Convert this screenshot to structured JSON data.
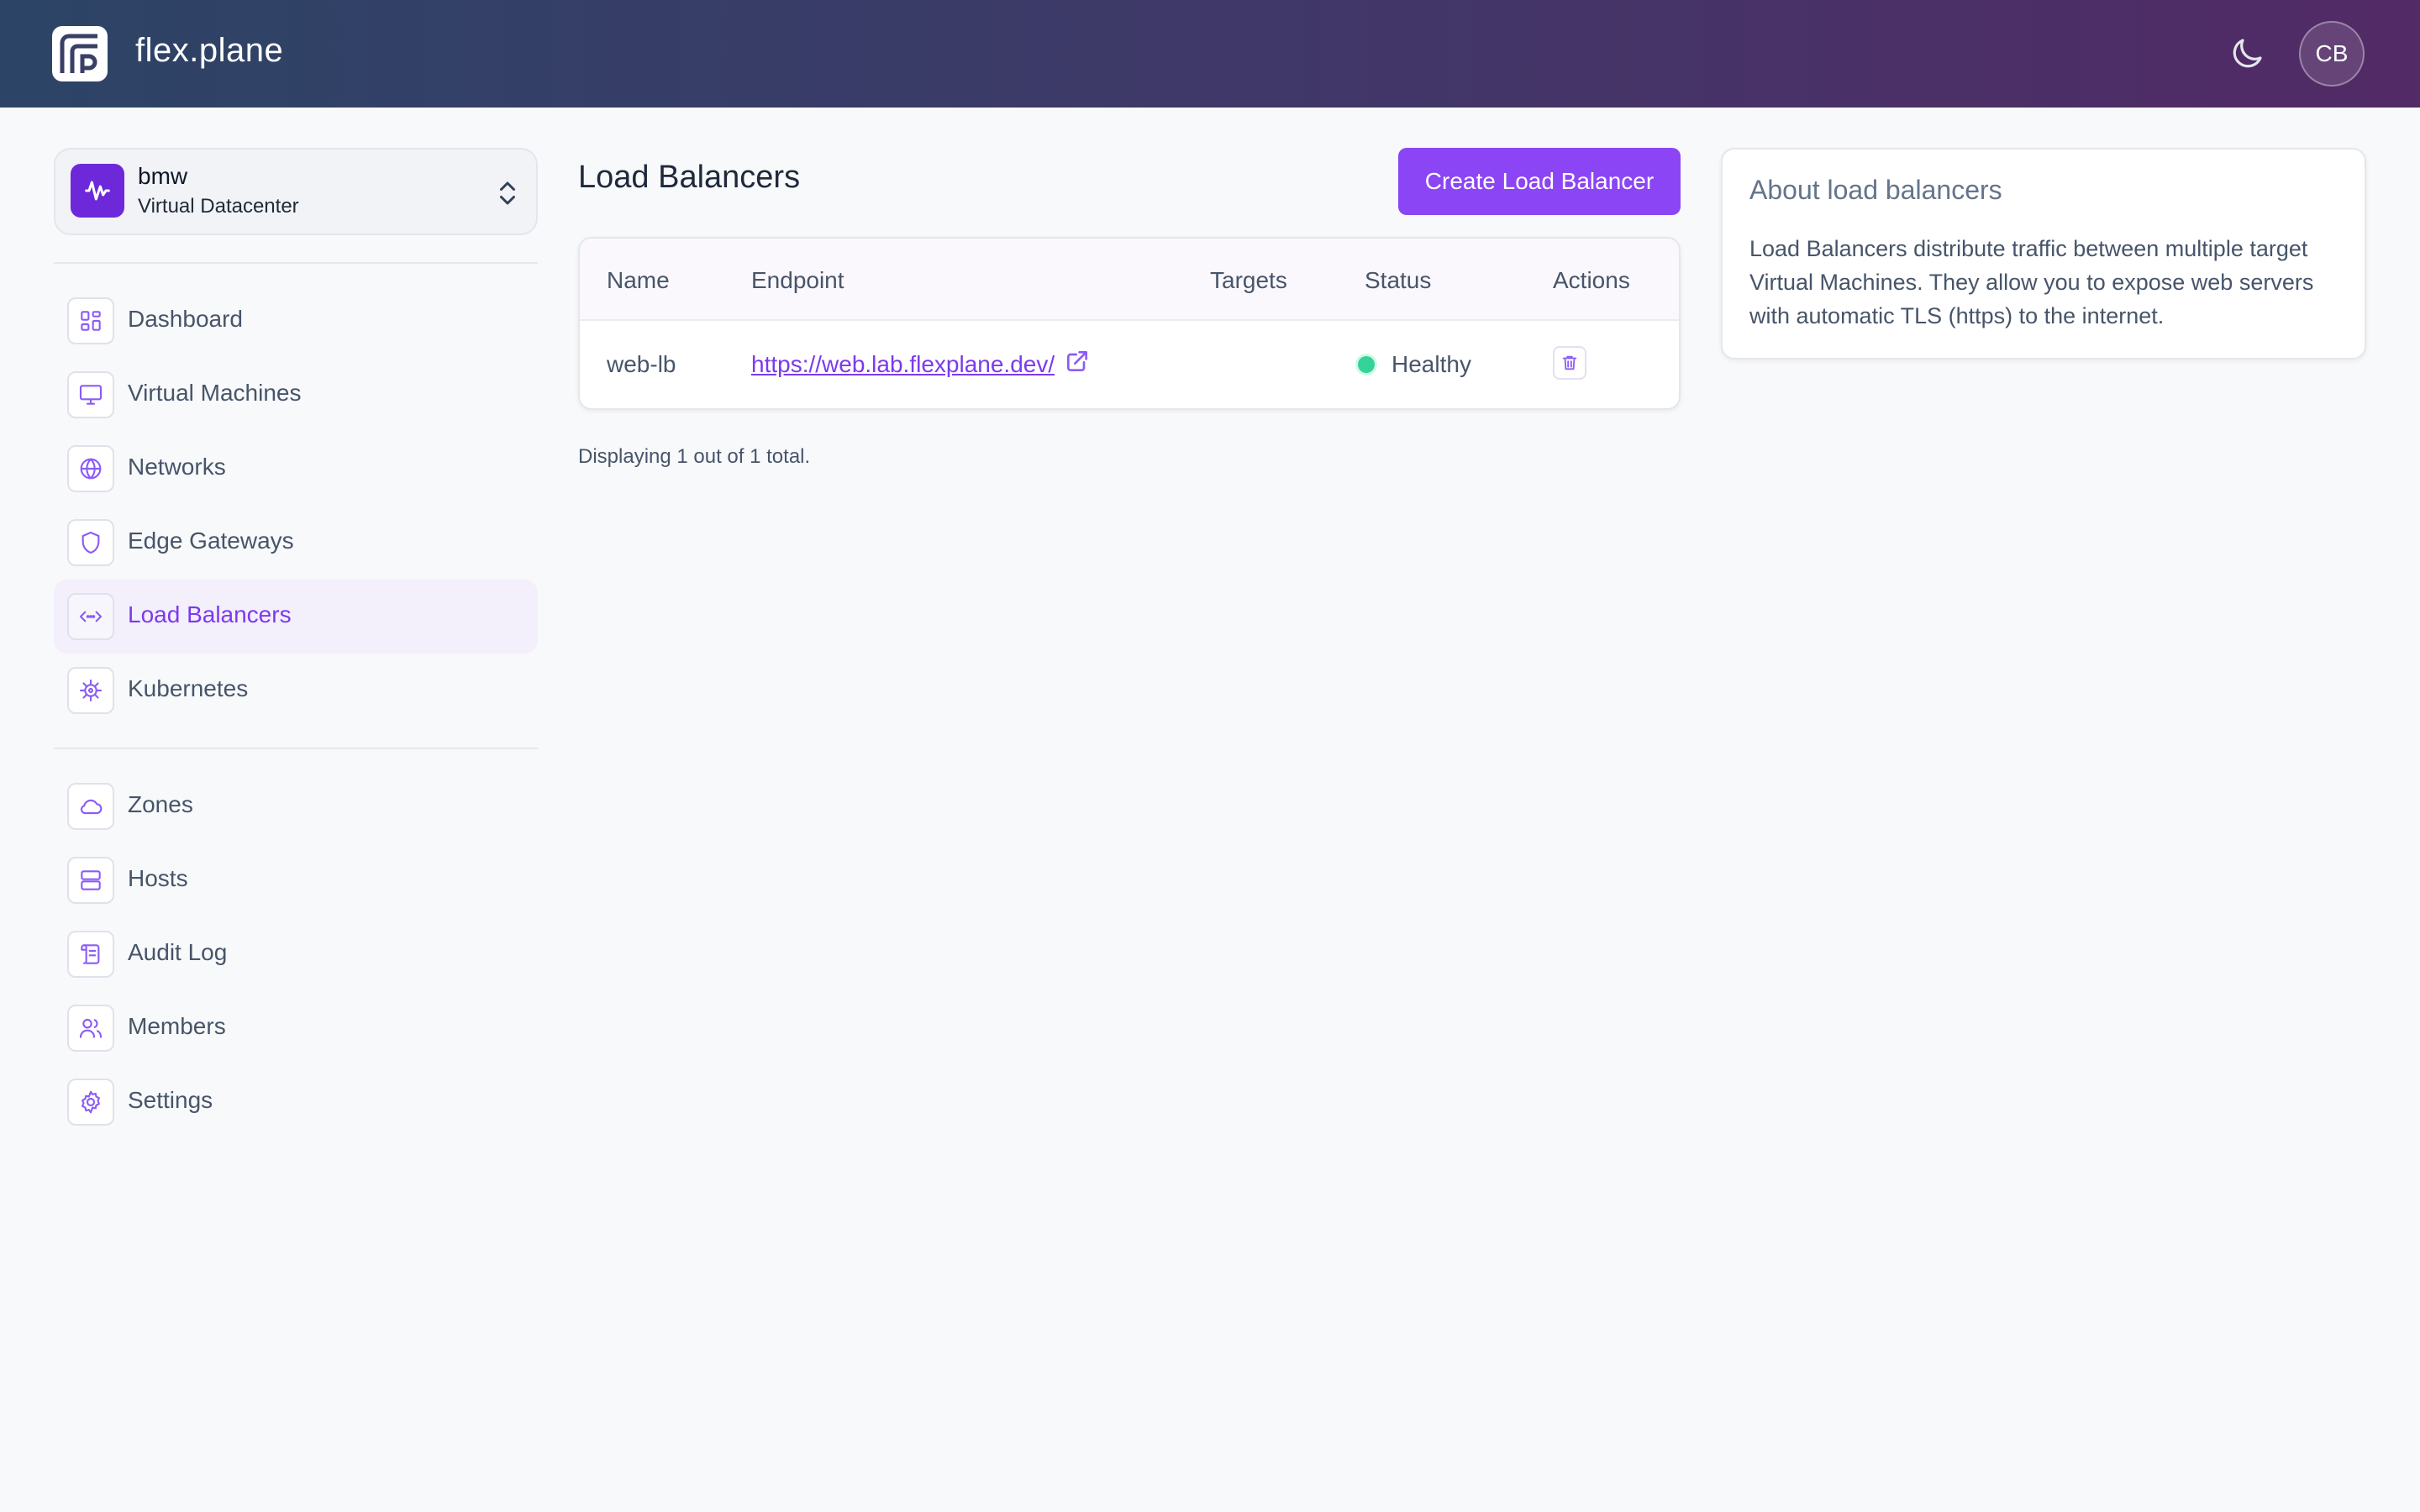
{
  "header": {
    "brand": "flex.plane",
    "avatar_initials": "CB",
    "gradient": [
      "#2c4466",
      "#522a66"
    ]
  },
  "context": {
    "name": "bmw",
    "type": "Virtual Datacenter",
    "accent": "#6d28d9"
  },
  "sidebar": {
    "primary": [
      {
        "label": "Dashboard",
        "icon": "grid-icon"
      },
      {
        "label": "Virtual Machines",
        "icon": "monitor-icon"
      },
      {
        "label": "Networks",
        "icon": "globe-icon"
      },
      {
        "label": "Edge Gateways",
        "icon": "shield-icon"
      },
      {
        "label": "Load Balancers",
        "icon": "code-icon",
        "active": true
      },
      {
        "label": "Kubernetes",
        "icon": "helm-icon"
      }
    ],
    "secondary": [
      {
        "label": "Zones",
        "icon": "cloud-icon"
      },
      {
        "label": "Hosts",
        "icon": "server-icon"
      },
      {
        "label": "Audit Log",
        "icon": "scroll-icon"
      },
      {
        "label": "Members",
        "icon": "users-icon"
      },
      {
        "label": "Settings",
        "icon": "gear-icon"
      }
    ]
  },
  "main": {
    "title": "Load Balancers",
    "create_label": "Create Load Balancer",
    "table": {
      "columns": [
        "Name",
        "Endpoint",
        "Targets",
        "Status",
        "Actions"
      ],
      "rows": [
        {
          "name": "web-lb",
          "endpoint": "https://web.lab.flexplane.dev/",
          "targets": "",
          "status": "Healthy",
          "status_color": "#34d399"
        }
      ]
    },
    "footnote": "Displaying 1 out of 1 total."
  },
  "info": {
    "title": "About load balancers",
    "body": "Load Balancers distribute traffic between multiple target Virtual Machines. They allow you to expose web servers with automatic TLS (https) to the internet."
  }
}
